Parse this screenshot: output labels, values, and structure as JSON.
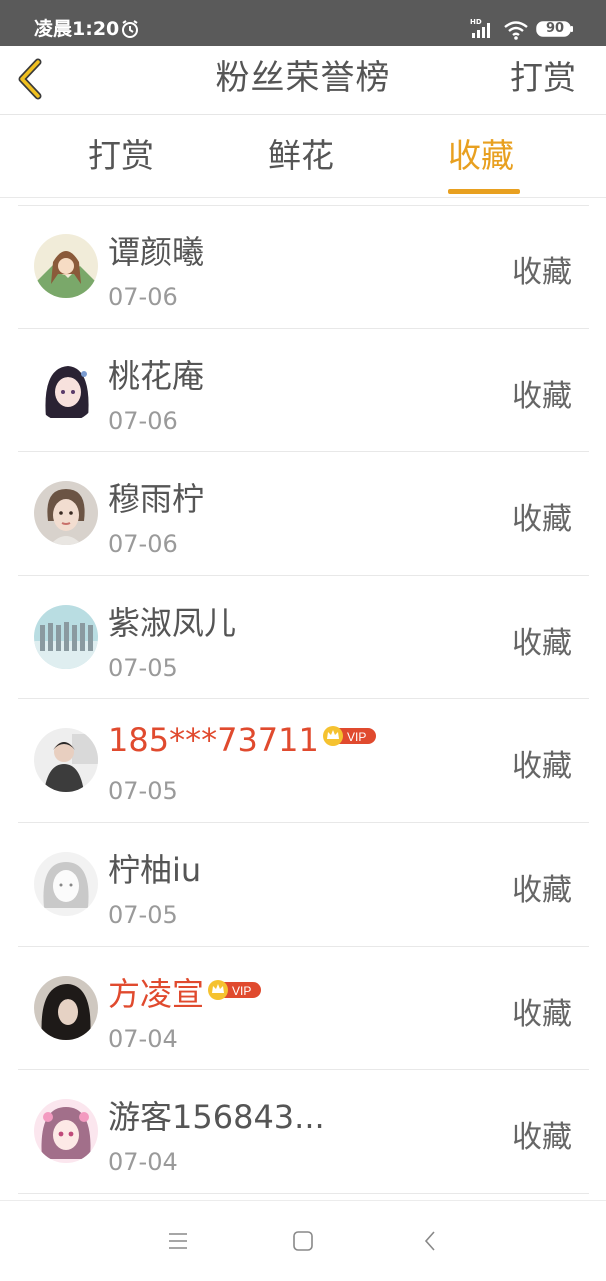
{
  "status_bar": {
    "time": "凌晨1:20",
    "hd": "HD",
    "battery": "90"
  },
  "nav": {
    "title": "粉丝荣誉榜",
    "action": "打赏"
  },
  "tabs": [
    {
      "label": "打赏",
      "active": false
    },
    {
      "label": "鲜花",
      "active": false
    },
    {
      "label": "收藏",
      "active": true
    }
  ],
  "colors": {
    "accent": "#e8a020",
    "vip_name": "#e04a2e",
    "status_bar_bg": "#5a5a5a"
  },
  "list": [
    {
      "name": "谭颜曦",
      "date": "07-06",
      "action": "收藏",
      "vip": false,
      "avatar": "avatar-girl-drawing"
    },
    {
      "name": "桃花庵",
      "date": "07-06",
      "action": "收藏",
      "vip": false,
      "avatar": "avatar-anime-girl"
    },
    {
      "name": "穆雨柠",
      "date": "07-06",
      "action": "收藏",
      "vip": false,
      "avatar": "avatar-girl-portrait"
    },
    {
      "name": "紫淑凤儿",
      "date": "07-05",
      "action": "收藏",
      "vip": false,
      "avatar": "avatar-group-photo"
    },
    {
      "name": "185***73711",
      "date": "07-05",
      "action": "收藏",
      "vip": true,
      "vip_label": "VIP",
      "avatar": "avatar-boy-photo"
    },
    {
      "name": "柠柚iu",
      "date": "07-05",
      "action": "收藏",
      "vip": false,
      "avatar": "avatar-sketch-girl"
    },
    {
      "name": "方凌宣",
      "date": "07-04",
      "action": "收藏",
      "vip": true,
      "vip_label": "VIP",
      "avatar": "avatar-dark-hair"
    },
    {
      "name": "游客156843...",
      "date": "07-04",
      "action": "收藏",
      "vip": false,
      "avatar": "avatar-pink-anime"
    }
  ],
  "system_nav": [
    "menu-icon",
    "home-icon",
    "back-icon"
  ]
}
